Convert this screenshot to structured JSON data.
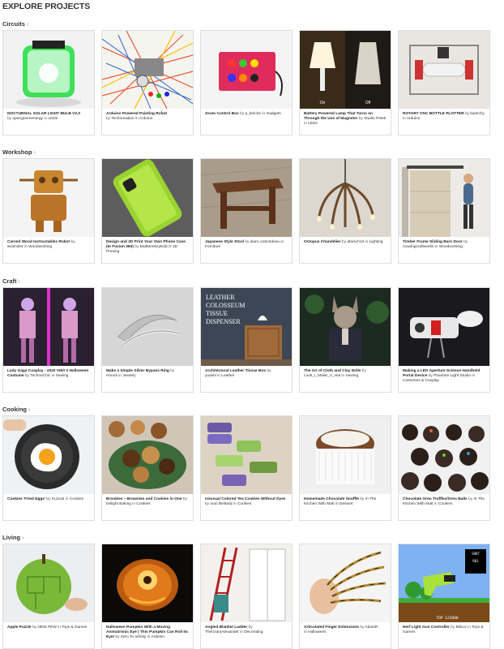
{
  "page": {
    "title": "EXPLORE PROJECTS"
  },
  "sections": [
    {
      "name": "Circuits",
      "projects": [
        {
          "title": "NOCTURNAL SOLAR LIGHT BULB V2.0",
          "by": "by",
          "author": "opengreenenergy",
          "in": "in",
          "category": "LEDs"
        },
        {
          "title": "Arduino Powered Painting Robot",
          "by": "by",
          "author": "Technovation",
          "in": "in",
          "category": "Arduino"
        },
        {
          "title": "Zoom Control Box",
          "by": "by",
          "author": "p_leriche",
          "in": "in",
          "category": "Gadgets"
        },
        {
          "title": "Battery Powered Lamp That Turns on Through the Use of Magnets!",
          "by": "by",
          "author": "Studio Petek",
          "in": "in",
          "category": "LEDs",
          "labels": [
            "On",
            "Off"
          ]
        },
        {
          "title": "ROTARY CNC BOTTLE PLOTTER",
          "by": "by",
          "author": "kaetichy",
          "in": "in",
          "category": "Arduino"
        }
      ]
    },
    {
      "name": "Workshop",
      "projects": [
        {
          "title": "Carved Wood Instructables Robot",
          "by": "by",
          "author": "seamster",
          "in": "in",
          "category": "Woodworking"
        },
        {
          "title": "Design and 3D Print Your Own Phone Case (In Fusion 360)",
          "by": "by",
          "author": "BadMonkeyEdd",
          "in": "in",
          "category": "3D Printing"
        },
        {
          "title": "Japanese Style Stool",
          "by": "by",
          "author": "diam.colonsdeau",
          "in": "in",
          "category": "Furniture"
        },
        {
          "title": "Octopus Chandelier",
          "by": "by",
          "author": "abusch13",
          "in": "in",
          "category": "Lighting"
        },
        {
          "title": "Timber Frame Sliding Barn Door",
          "by": "by",
          "author": "cowdogcraftworks",
          "in": "in",
          "category": "Woodworking"
        }
      ]
    },
    {
      "name": "Craft",
      "projects": [
        {
          "title": "Lady Gaga Cosplay - 2020 VMA's Halloween Costume",
          "by": "by",
          "author": "TechnoChic",
          "in": "in",
          "category": "Sewing"
        },
        {
          "title": "Make a Simple Silver Bypass Ring",
          "by": "by",
          "author": "Honus",
          "in": "in",
          "category": "Jewelry"
        },
        {
          "title": "Architectural Leather Tissue Box",
          "by": "by",
          "author": "yuashi",
          "in": "in",
          "category": "Leather",
          "overlay": [
            "LEATHER",
            "COLOSSEUM",
            "TISSUE",
            "DISPENSER"
          ]
        },
        {
          "title": "The Art of Cloth and Clay Dolls",
          "by": "by",
          "author": "Look_I_Made_A_Hat",
          "in": "in",
          "category": "Sewing"
        },
        {
          "title": "Making a LED Aperture Science Handheld Portal Device",
          "by": "by",
          "author": "Phantom Light Studio",
          "in": "in",
          "category": "Costumes & Cosplay"
        }
      ]
    },
    {
      "name": "Cooking",
      "projects": [
        {
          "title": "Cookies 'Fried Eggs'",
          "by": "by",
          "author": "Kuza.B",
          "in": "in",
          "category": "Cookies"
        },
        {
          "title": "Brookies – Brownies and Cookies in One",
          "by": "by",
          "author": "Delight Baking",
          "in": "in",
          "category": "Cookies"
        },
        {
          "title": "Unusual Colored Tea Cookies Without Dyes",
          "by": "by",
          "author": "Ivan Belitanji",
          "in": "in",
          "category": "Cookies"
        },
        {
          "title": "Homemade Chocolate Soufflé",
          "by": "by",
          "author": "In The Kitchen With Matt",
          "in": "in",
          "category": "Dessert"
        },
        {
          "title": "Chocolate Oreo Truffles/Oreo Balls",
          "by": "by",
          "author": "In The Kitchen With Matt",
          "in": "in",
          "category": "Cookies"
        }
      ]
    },
    {
      "name": "Living",
      "projects": [
        {
          "title": "Apple Puzzle",
          "by": "by",
          "author": "NEW PEW",
          "in": "in",
          "category": "Toys & Games"
        },
        {
          "title": "Halloween Pumpkin With a Moving Animatronic Eye | This Pumpkin Can Roll Its Eye!",
          "by": "by",
          "author": "Zero To Infinity",
          "in": "in",
          "category": "Arduino"
        },
        {
          "title": "Angled Blanket Ladder",
          "by": "by",
          "author": "TheGrantAlexander",
          "in": "in",
          "category": "Decorating"
        },
        {
          "title": "Articulated Finger Extensions",
          "by": "by",
          "author": "AdamR",
          "in": "in",
          "category": "Halloween"
        },
        {
          "title": "Nerf Light Gun Controller",
          "by": "by",
          "author": "BittLiv",
          "in": "in",
          "category": "Toys & Games",
          "hud": [
            "SHOT",
            "R01",
            "TOP 122000"
          ]
        }
      ]
    }
  ],
  "colors": {
    "section_link": "#333333",
    "card_border": "#dedede",
    "title_text": "#222222",
    "meta_text": "#555555"
  },
  "icons": {
    "section_chevron": "chevron-right-icon"
  }
}
